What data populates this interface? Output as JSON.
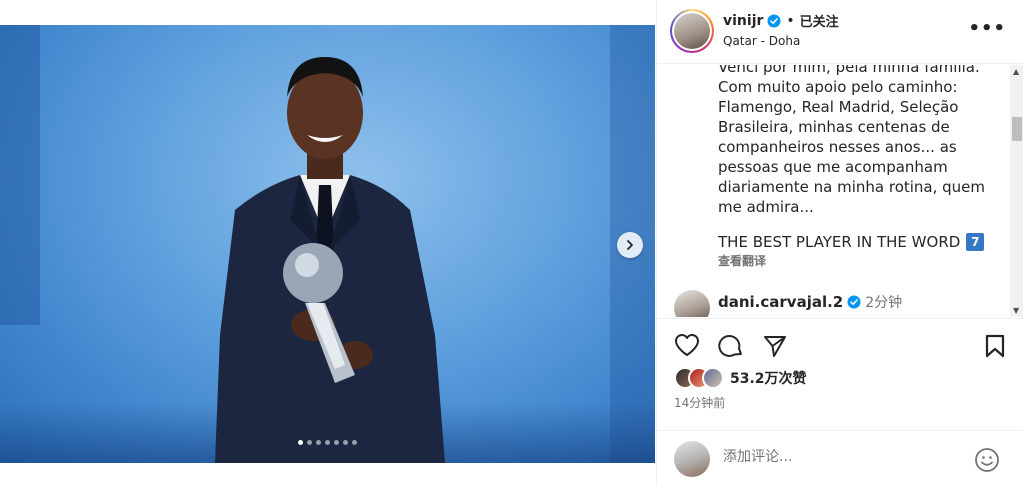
{
  "post": {
    "username": "vinijr",
    "follow_status": "已关注",
    "separator": "•",
    "location": "Qatar - Doha",
    "more_label": "•••"
  },
  "caption": {
    "text": "Venci por mim, pela minha família.\nCom muito apoio pelo caminho:\nFlamengo, Real Madrid, Seleção\nBrasileira, minhas centenas de\ncompanheiros nesses anos... as\npessoas que me acompanham\ndiariamente na minha rotina, quem\nme admira...",
    "best_line": "THE BEST PLAYER IN THE WORD",
    "emoji": "7",
    "translate": "查看翻译"
  },
  "comment": {
    "username": "dani.carvajal.2",
    "time": "2分钟"
  },
  "stats": {
    "likes": "53.2万次赞",
    "time_ago": "14分钟前"
  },
  "add_comment": {
    "placeholder": "添加评论..."
  },
  "carousel": {
    "dot_count": 7,
    "active_index": 0
  },
  "colors": {
    "verified": "#0095f6",
    "text": "#262626",
    "secondary": "#737373"
  }
}
